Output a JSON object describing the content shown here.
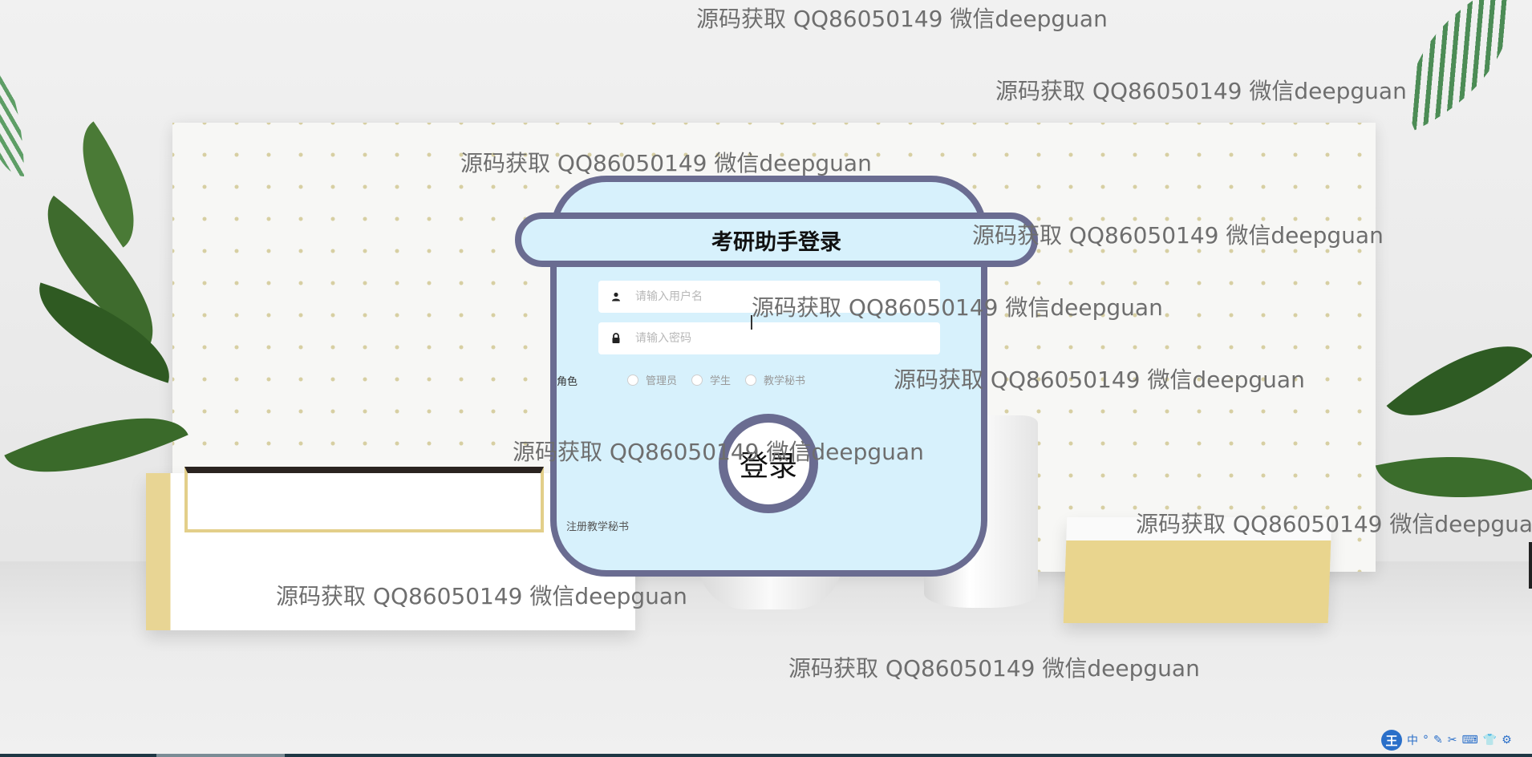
{
  "title": "考研助手登录",
  "form": {
    "username_placeholder": "请输入用户名",
    "password_placeholder": "请输入密码",
    "role_label": "角色",
    "roles": [
      "管理员",
      "学生",
      "教学秘书"
    ],
    "login_button": "登录",
    "register_link": "注册教学秘书"
  },
  "watermark_text": "源码获取 QQ86050149 微信deepguan",
  "ime": {
    "logo": "王",
    "items": [
      "中",
      "°",
      "✎",
      "✂",
      "⌨",
      "👕",
      "⚙"
    ]
  },
  "colors": {
    "card_bg": "#d7f1fc",
    "card_border": "#6a6c91"
  }
}
